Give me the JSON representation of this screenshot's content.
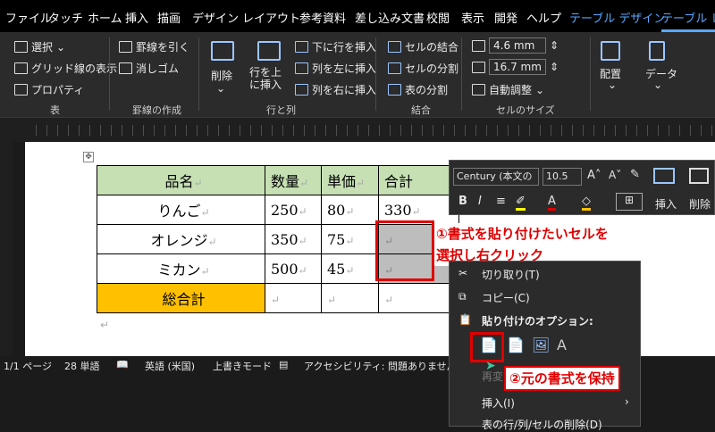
{
  "menubar": {
    "tabs": [
      "ファイル",
      "タッチ",
      "ホーム",
      "挿入",
      "描画",
      "デザイン",
      "レイアウト",
      "参考資料",
      "差し込み文書",
      "校閲",
      "表示",
      "開発",
      "ヘルプ"
    ],
    "context_tab": "テーブル デザイン",
    "active_tab": "テーブル レイ"
  },
  "ribbon": {
    "select": "選択",
    "gridlines": "グリッド線の表示",
    "properties": "プロパティ",
    "grp_table": "表",
    "draw_border": "罫線を引く",
    "eraser": "消しゴム",
    "grp_draw": "罫線の作成",
    "delete": "削除",
    "insert_above": "行を上に挿入",
    "insert_below": "下に行を挿入",
    "insert_left": "列を左に挿入",
    "insert_right": "列を右に挿入",
    "grp_rows": "行と列",
    "merge": "セルの結合",
    "split": "セルの分割",
    "split_table": "表の分割",
    "grp_merge": "結合",
    "height": "4.6 mm",
    "width": "16.7 mm",
    "autofit": "自動調整",
    "grp_size": "セルのサイズ",
    "align": "配置",
    "data": "データ"
  },
  "table": {
    "headers": [
      "品名",
      "数量",
      "単価",
      "合計"
    ],
    "rows": [
      [
        "りんご",
        "250",
        "80",
        "330"
      ],
      [
        "オレンジ",
        "350",
        "75",
        ""
      ],
      [
        "ミカン",
        "500",
        "45",
        ""
      ]
    ],
    "total_label": "総合計",
    "colors": {
      "header": "#c6e0b4",
      "total": "#ffc000",
      "selected": "#bdbdbd"
    },
    "para_mark": "↵"
  },
  "minibar": {
    "font": "Century (本文の",
    "size": "10.5",
    "insert": "挿入",
    "delete": "削除"
  },
  "context_menu": {
    "cut": "切り取り(T)",
    "copy": "コピー(C)",
    "paste_options": "貼り付けのオプション:",
    "smart": "再変",
    "insert": "挿入(I)",
    "delete_cells": "表の行/列/セルの削除(D)"
  },
  "callouts": {
    "step1_line1": "①書式を貼り付けたいセルを",
    "step1_line2": "選択し右クリック",
    "step2": "②元の書式を保持"
  },
  "status": {
    "page": "1/1 ページ",
    "words": "28 単語",
    "lang": "英語 (米国)",
    "mode": "上書きモード",
    "access": "アクセシビリティ: 問題ありません"
  }
}
